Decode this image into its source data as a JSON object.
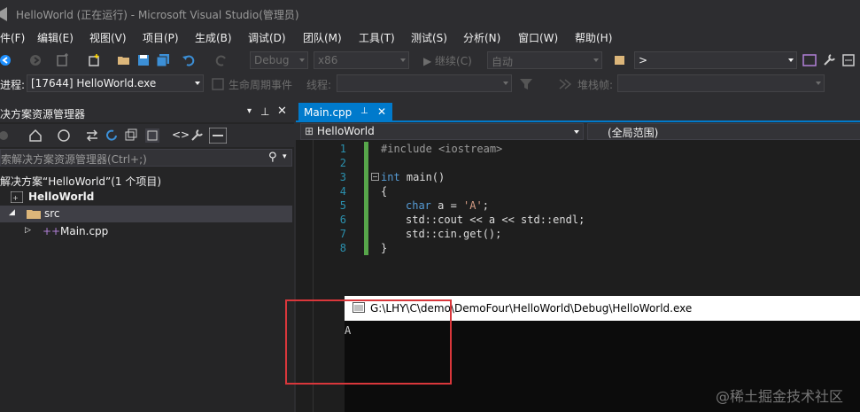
{
  "window": {
    "title": "HelloWorld (正在运行) - Microsoft Visual Studio(管理员)"
  },
  "menu": [
    "件(F)",
    "编辑(E)",
    "视图(V)",
    "项目(P)",
    "生成(B)",
    "调试(D)",
    "团队(M)",
    "工具(T)",
    "测试(S)",
    "分析(N)",
    "窗口(W)",
    "帮助(H)"
  ],
  "toolbar": {
    "config": "Debug",
    "platform": "x86",
    "continue": "继续(C)",
    "auto": "自动",
    "find_box": ">"
  },
  "debugbar": {
    "process_label": "进程:",
    "process_value": "[17644] HelloWorld.exe",
    "lifecycle_label": "生命周期事件",
    "thread_label": "线程:",
    "stackframe_label": "堆栈帧:"
  },
  "solution_explorer": {
    "header": "决方案资源管理器",
    "search_placeholder": "索解决方案资源管理器(Ctrl+;)",
    "tree": [
      {
        "label": "解决方案“HelloWorld”(1 个项目)"
      },
      {
        "label": "HelloWorld"
      },
      {
        "label": "src"
      },
      {
        "label": "Main.cpp"
      }
    ]
  },
  "editor": {
    "tab": "Main.cpp",
    "nav_left": "HelloWorld",
    "nav_right": "(全局范围)",
    "line_numbers": [
      "1",
      "2",
      "3",
      "4",
      "5",
      "6",
      "7",
      "8"
    ],
    "code": {
      "l1_pp": "#include <iostream>",
      "l3_kw": "int",
      "l3_rest": " main()",
      "l4": "{",
      "l5_kw": "char",
      "l5_rest": " a = ",
      "l5_str": "'A'",
      "l5_end": ";",
      "l6": "std::cout << a << std::endl;",
      "l7": "std::cin.get();",
      "l8": "}"
    }
  },
  "console": {
    "title": "G:\\LHY\\C\\demo\\DemoFour\\HelloWorld\\Debug\\HelloWorld.exe",
    "output": "A"
  },
  "watermark": "@稀土掘金技术社区",
  "colors": {
    "accent": "#007acc",
    "annotation": "#d9373b",
    "change_bar": "#57a64a"
  }
}
